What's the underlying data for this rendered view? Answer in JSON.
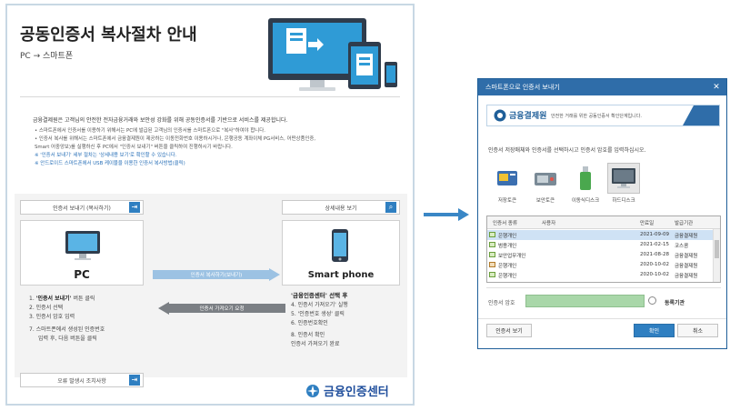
{
  "guide": {
    "title": "공동인증서 복사절차 안내",
    "subtitle": "PC → 스마트폰",
    "intro": "금융결제원은 고객님의 안전한 전자금융거래와 보안성 강화를 위해 공동인증서를 기반으로 서비스를 제공합니다.",
    "bullets": [
      "• 스마트폰에서 인증서를 이용하기 위해서는 PC에 발급된 고객님의 인증서를 스마트폰으로 \"복사\"하여야 합니다.",
      "• 인증서 복사를 위해서는 스마트폰에서 금융결제원이 제공하는 이동전화번호 이용하시거나, 은행공동 계좌이체 PG서비스, 어떤상품인증,",
      "  Smart 어중앙보)를 실행하신 후 PC에서 \"인증서 보내기\" 버튼을 클릭하여 진행하시기 바랍니다."
    ],
    "notes": [
      "※ '인증서 보내기' 세부 절차는 '상세내용 보기'로 확인할 수 있습니다.",
      "※ 안드로이드 스마트폰에서 USB 케이블을 이용한 인증서 복사방법(클릭)"
    ],
    "send_cert_btn": "인증서 보내기 (복사하기)",
    "detail_btn": "상세내용 보기",
    "pc_label": "PC",
    "phone_label": "Smart phone",
    "arrow_copy": "인증서 복사하기(보내기)",
    "arrow_request": "인증서 가져오기 요청",
    "pc_steps": [
      {
        "num": "1.",
        "bold": "'인증서 보내기'",
        "text": " 버튼 클릭"
      },
      {
        "num": "2.",
        "bold": "",
        "text": "인증서 선택"
      },
      {
        "num": "3.",
        "bold": "",
        "text": "인증서 암호 입력"
      },
      {
        "num": "7.",
        "bold": "",
        "text": "스마트폰에서 생성된 인증번호"
      },
      {
        "num": "",
        "bold": "",
        "text": "입력 후, 다음 버튼을 클릭"
      }
    ],
    "phone_steps_title": "'금융인증센터' 선택 후",
    "phone_steps": [
      "4.  인증서 가져오기' 실행",
      "5.  '인증번호 생성' 클릭",
      "6.  인증번호확인",
      "8.  인증서 확인",
      "     인증서 가져오기 완료"
    ],
    "error_btn": "오류 발생시 조치사항",
    "footer_logo": "금융인증센터"
  },
  "dialog": {
    "title": "스마트폰으로 인증서 보내기",
    "close_glyph": "✕",
    "banner_logo": "금융결제원",
    "banner_desc": "안전한 거래를 위한 공동인증서 확인단계입니다.",
    "instruction": "인증서 저장매체와 인증서를 선택하시고 인증서 암호를 입력하십시오.",
    "devices": [
      {
        "label": "저장토큰",
        "icon": "storage-token-icon"
      },
      {
        "label": "보안토큰",
        "icon": "security-token-icon"
      },
      {
        "label": "이동식디스크",
        "icon": "usb-drive-icon"
      },
      {
        "label": "하드디스크",
        "icon": "hard-disk-icon",
        "selected": true
      }
    ],
    "columns": [
      "인증서 종류",
      "사용자",
      "만료일",
      "발급기관"
    ],
    "rows": [
      {
        "type": "은행개인",
        "user": "",
        "expiry": "2021-09-09",
        "issuer": "금융결제원",
        "selected": true
      },
      {
        "type": "범용개인",
        "user": "",
        "expiry": "2021-02-15",
        "issuer": "코스콤",
        "selected": false
      },
      {
        "type": "보안업무개인",
        "user": "",
        "expiry": "2021-08-28",
        "issuer": "금융결제원",
        "selected": false
      },
      {
        "type": "은행개인",
        "user": "",
        "expiry": "2020-10-02",
        "issuer": "금융결제원",
        "selected": false
      },
      {
        "type": "은행개인",
        "user": "",
        "expiry": "2020-10-02",
        "issuer": "금융결제원",
        "selected": false
      }
    ],
    "password_label": "인증서 암호",
    "password_value": "",
    "secure_label": "동록기관",
    "view_btn": "인증서 보기",
    "ok_btn": "확인",
    "cancel_btn": "취소"
  },
  "colors": {
    "accent": "#2f7fc1",
    "titlebar": "#2f6da9",
    "selected_row": "#cfe2f5",
    "password_field": "#a9d7a9"
  }
}
